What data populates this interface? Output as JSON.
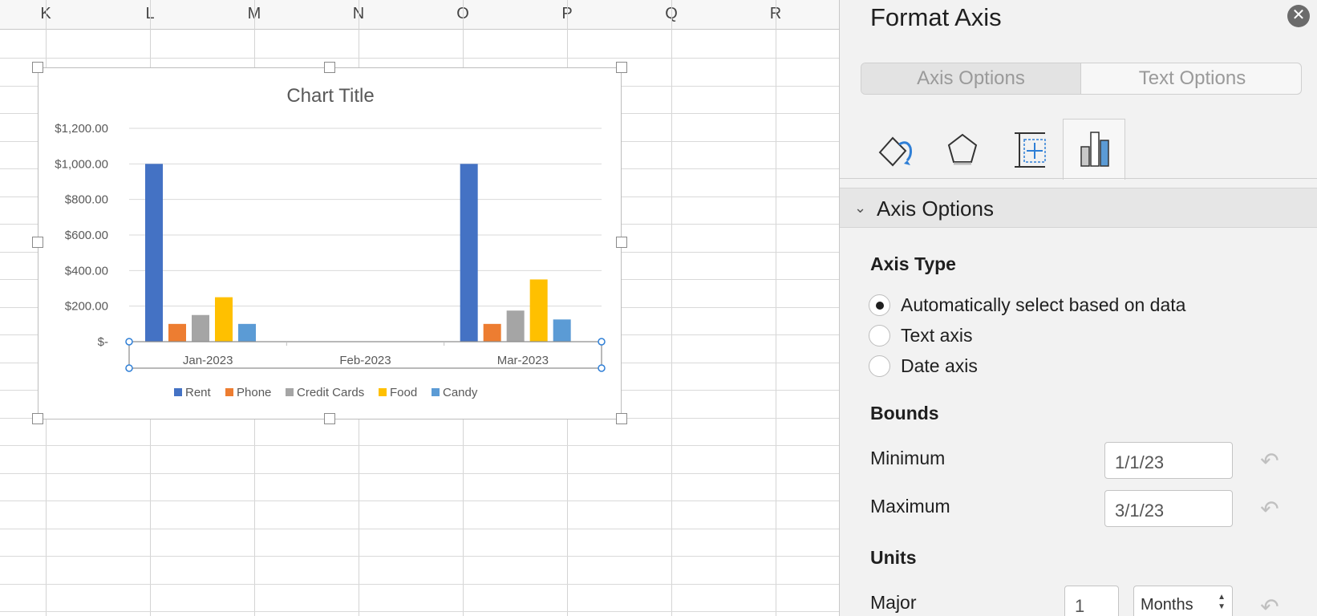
{
  "sheet": {
    "columns": [
      "K",
      "L",
      "M",
      "N",
      "O",
      "P",
      "Q",
      "R"
    ]
  },
  "chart_data": {
    "type": "bar",
    "title": "Chart Title",
    "categories": [
      "Jan-2023",
      "Feb-2023",
      "Mar-2023"
    ],
    "series": [
      {
        "name": "Rent",
        "color": "#4472C4",
        "values": [
          1000,
          0,
          1000
        ]
      },
      {
        "name": "Phone",
        "color": "#ED7D31",
        "values": [
          100,
          0,
          100
        ]
      },
      {
        "name": "Credit Cards",
        "color": "#A5A5A5",
        "values": [
          150,
          0,
          175
        ]
      },
      {
        "name": "Food",
        "color": "#FFC000",
        "values": [
          250,
          0,
          350
        ]
      },
      {
        "name": "Candy",
        "color": "#5B9BD5",
        "values": [
          100,
          0,
          125
        ]
      }
    ],
    "ylim": [
      0,
      1200
    ],
    "yticks": [
      0,
      200,
      400,
      600,
      800,
      1000,
      1200
    ],
    "ytick_labels": [
      "$-",
      "$200.00",
      "$400.00",
      "$600.00",
      "$800.00",
      "$1,000.00",
      "$1,200.00"
    ],
    "grid": true,
    "legend_position": "bottom"
  },
  "pane": {
    "title": "Format Axis",
    "close_label": "✕",
    "tabs": [
      "Axis Options",
      "Text Options"
    ],
    "icon_tabs": [
      "fill-line-icon",
      "effects-icon",
      "size-properties-icon",
      "axis-options-icon"
    ],
    "section_label": "Axis Options",
    "axis_type": {
      "title": "Axis Type",
      "options": [
        "Automatically select based on data",
        "Text axis",
        "Date axis"
      ],
      "selected": 0
    },
    "bounds": {
      "title": "Bounds",
      "min_label": "Minimum",
      "min_value": "1/1/23",
      "max_label": "Maximum",
      "max_value": "3/1/23"
    },
    "units": {
      "title": "Units",
      "major_label": "Major",
      "major_value": "1",
      "major_unit": "Months"
    },
    "reset_glyph": "↶"
  }
}
